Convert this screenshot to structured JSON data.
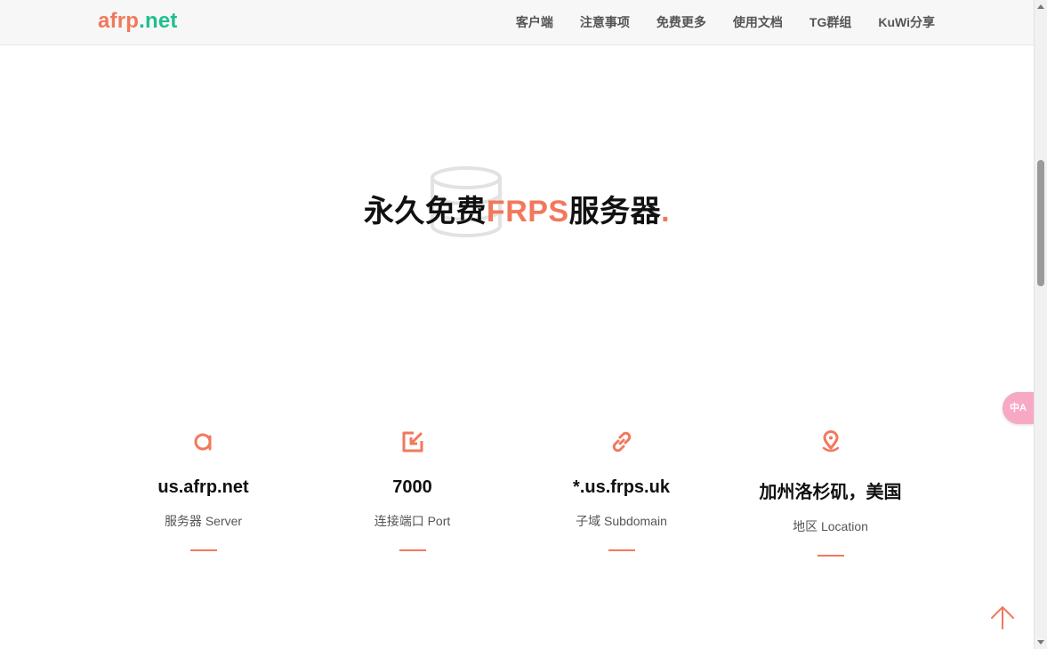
{
  "header": {
    "logo": {
      "part1": "afrp",
      "part2": ".",
      "part3": "net"
    },
    "nav": [
      {
        "label": "客户端"
      },
      {
        "label": "注意事项"
      },
      {
        "label": "免费更多"
      },
      {
        "label": "使用文档"
      },
      {
        "label": "TG群组"
      },
      {
        "label": "KuWi分享"
      }
    ]
  },
  "hero": {
    "title_prefix": "永久免费",
    "title_accent": "FRPS",
    "title_suffix": "服务器",
    "title_dot": ".",
    "bg_icon": "database-icon"
  },
  "stats": [
    {
      "icon": "at-sign-icon",
      "value": "us.afrp.net",
      "label": "服务器 Server"
    },
    {
      "icon": "port-arrow-icon",
      "value": "7000",
      "label": "连接端口 Port"
    },
    {
      "icon": "link-icon",
      "value": "*.us.frps.uk",
      "label": "子域 Subdomain"
    },
    {
      "icon": "location-pin-icon",
      "value": "加州洛杉矶，美国",
      "label": "地区 Location"
    }
  ],
  "translate_badge": {
    "label": "中A"
  },
  "colors": {
    "accent": "#f2785c",
    "logo_green": "#1fbf8f"
  }
}
